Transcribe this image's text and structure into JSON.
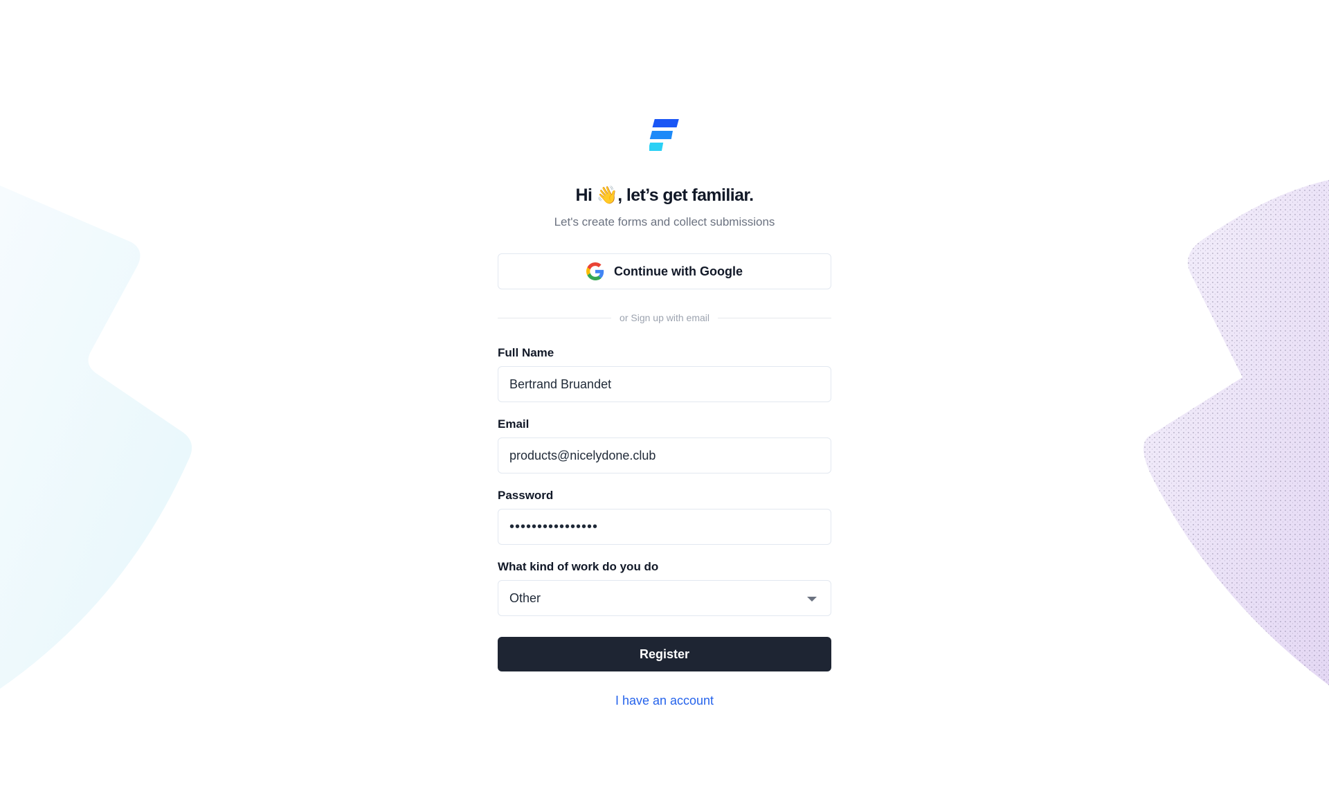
{
  "heading": {
    "title_prefix": "Hi ",
    "wave_emoji": "👋",
    "title_suffix": ", let’s get familiar.",
    "subtitle": "Let's create forms and collect submissions"
  },
  "google_button": {
    "label": "Continue with Google",
    "icon": "google-g-icon"
  },
  "divider": {
    "text": "or Sign up with email"
  },
  "form": {
    "full_name": {
      "label": "Full Name",
      "value": "Bertrand Bruandet"
    },
    "email": {
      "label": "Email",
      "value": "products@nicelydone.club"
    },
    "password": {
      "label": "Password",
      "value": "••••••••••••••••"
    },
    "work": {
      "label": "What kind of work do you do",
      "selected": "Other"
    }
  },
  "register_button": {
    "label": "Register"
  },
  "account_link": {
    "label": "I have an account"
  },
  "colors": {
    "primary_button": "#1e2533",
    "link": "#2563eb",
    "logo_top": "#1a56f5",
    "logo_mid": "#1e8af8",
    "logo_bottom": "#2ad0f5"
  }
}
